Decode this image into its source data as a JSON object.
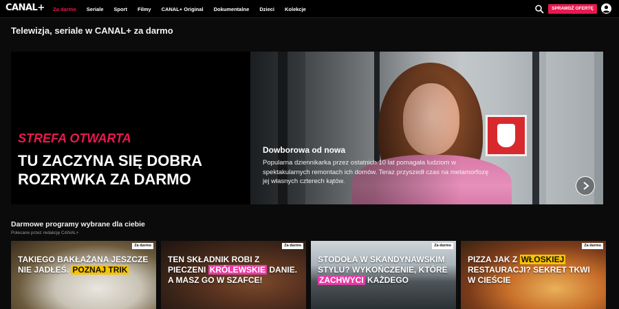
{
  "nav": {
    "logo": "CANAL+",
    "links": [
      "Za darmo",
      "Seriale",
      "Sport",
      "Filmy",
      "CANAL+ Original",
      "Dokumentalne",
      "Dzieci",
      "Kolekcje"
    ],
    "active_index": 0,
    "cta_label": "SPRAWDŹ OFERTĘ",
    "search_icon": "search-icon",
    "avatar_icon": "user-avatar-icon"
  },
  "page": {
    "title": "Telewizja, seriale w CANAL+ za darmo"
  },
  "hero": {
    "kicker": "STREFA OTWARTA",
    "headline": "TU ZACZYNA SIĘ DOBRA ROZRYWKA ZA DARMO",
    "show_title": "Dowborowa od nowa",
    "description": "Popularna dziennikarka przez ostatnich 10 lat pomagała ludziom w spektakularnych remontach ich domów. Teraz przyszedł czas na metamorfozę jej własnych czterech kątów.",
    "next_icon": "chevron-right-icon"
  },
  "section": {
    "title": "Darmowe programy wybrane dla ciebie",
    "subtitle": "Polecane przez redakcję CANAL+"
  },
  "cards": [
    {
      "badge": "Za darmo",
      "line1": "TAKIEGO BAKŁAŻANA JESZCZE NIE JADŁEŚ.",
      "highlight": "POZNAJ TRIK",
      "line2": "",
      "hl_color": "yellow"
    },
    {
      "badge": "Za darmo",
      "line1": "TEN SKŁADNIK ROBI Z PIECZENI",
      "highlight": "KRÓLEWSKIE",
      "line2": "DANIE. A MASZ GO W SZAFCE!",
      "hl_color": "pink"
    },
    {
      "badge": "Za darmo",
      "line1": "STODOŁA W SKANDYNAWSKIM STYLU? WYKOŃCZENIE, KTÓRE",
      "highlight": "ZACHWYCI",
      "line2": "KAŻDEGO",
      "hl_color": "pink"
    },
    {
      "badge": "Za darmo",
      "line1": "PIZZA JAK Z",
      "highlight": "WŁOSKIEJ",
      "line2": "RESTAURACJI? SEKRET TKWI W CIEŚCIE",
      "hl_color": "yellow"
    }
  ]
}
